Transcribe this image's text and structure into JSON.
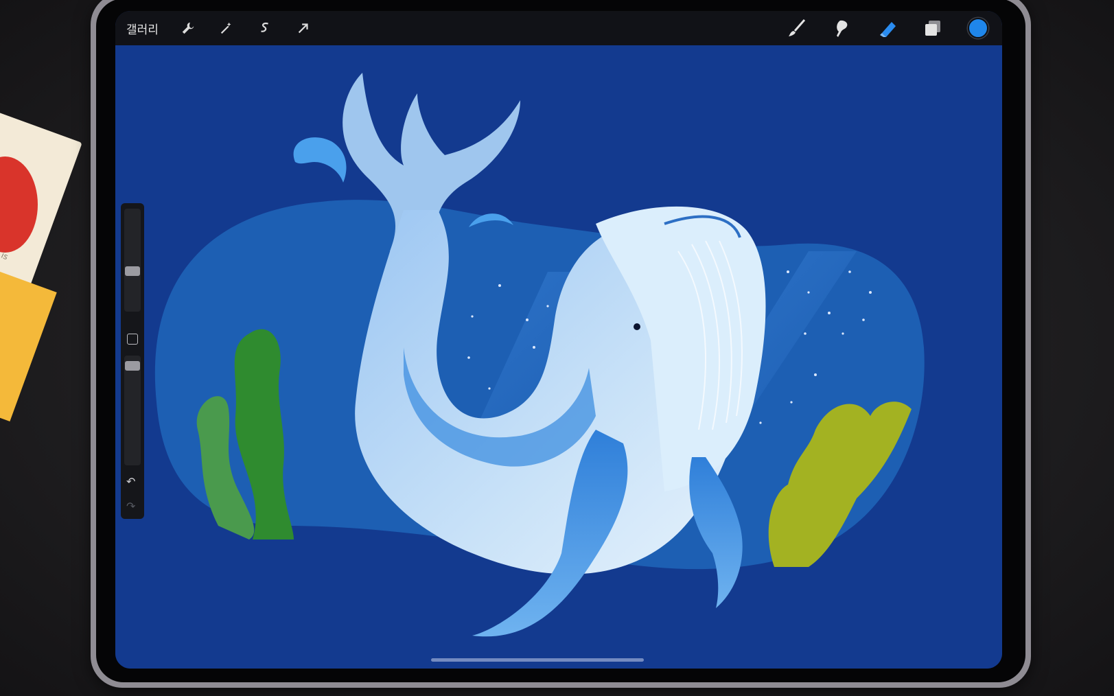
{
  "toolbar": {
    "gallery_label": "갤러리",
    "left_tools": [
      "wrench-icon",
      "magic-wand-icon",
      "selection-icon",
      "transform-arrow-icon"
    ],
    "right_tools": [
      "brush-icon",
      "smudge-icon",
      "eraser-icon",
      "layers-icon"
    ],
    "current_color": "#1f86ea",
    "active_tool": "eraser-icon"
  },
  "sidebar": {
    "brush_size_slider": "brush-size-slider",
    "opacity_slider": "opacity-slider",
    "modify_button": "modify-square-button",
    "undo_icon": "undo-icon",
    "redo_icon": "redo-icon"
  },
  "artwork": {
    "subject": "whale-illustration",
    "colors": {
      "background": "#133a8f",
      "blob": "#1d5fb3",
      "whale_light": "#bcd9f5",
      "whale_mid": "#5aa4ec",
      "seaweed_green": "#3f9b3c",
      "seaweed_yellow": "#a5b325"
    }
  },
  "desk_card": {
    "text": "is"
  }
}
